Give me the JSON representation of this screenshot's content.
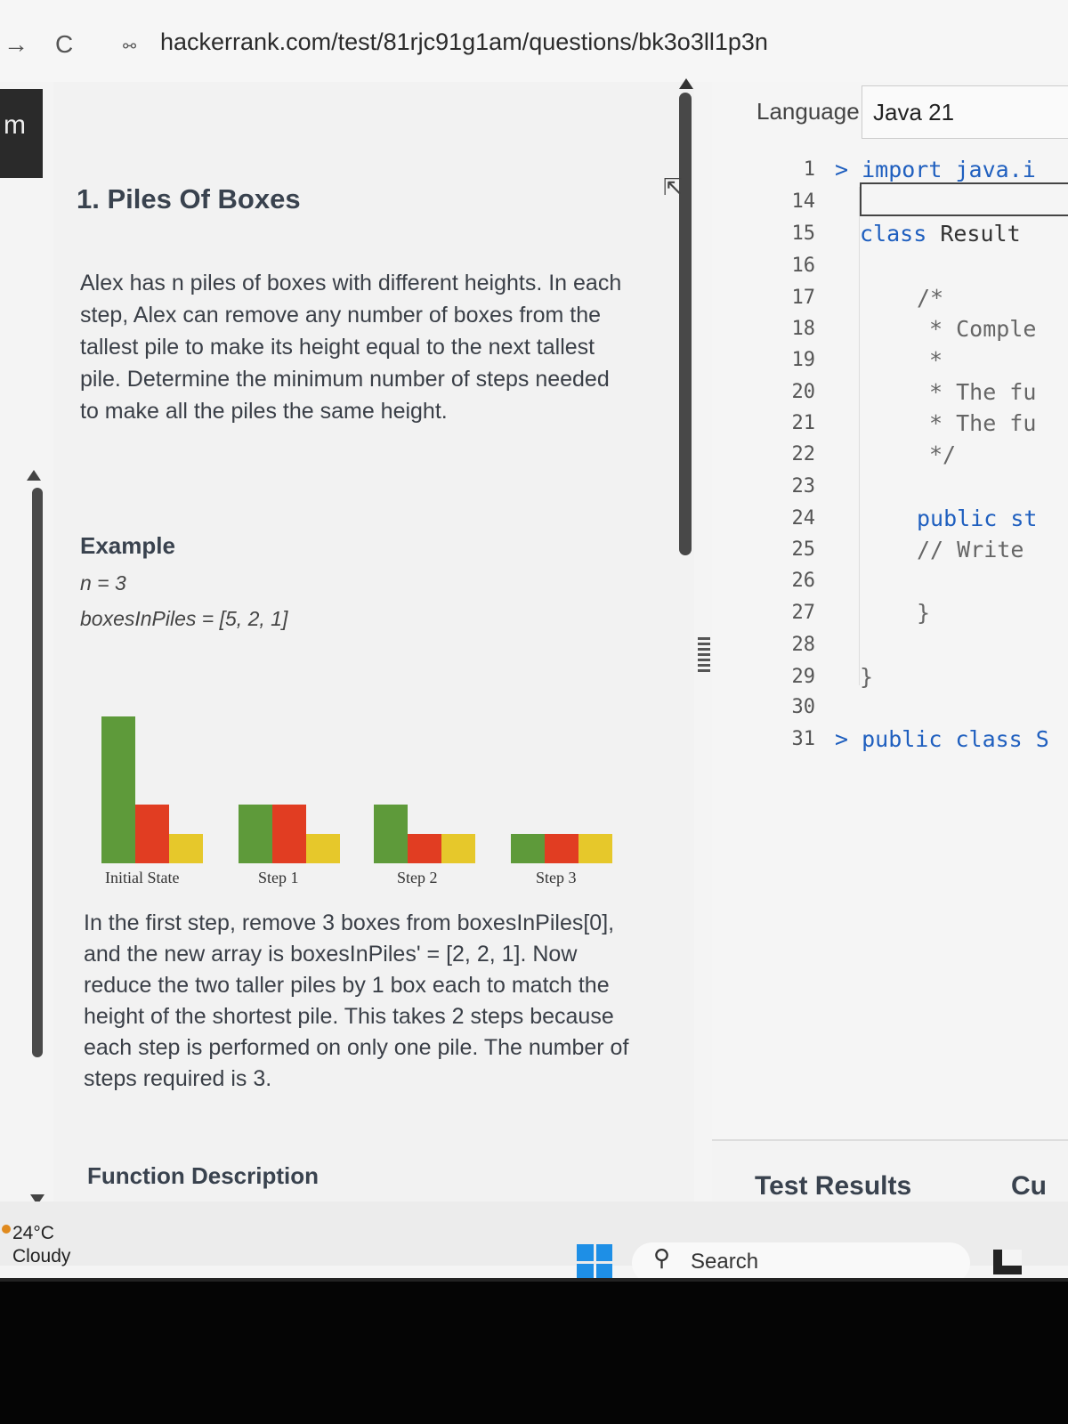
{
  "browser": {
    "back_glyph": "→",
    "reload_glyph": "C",
    "url": "hackerrank.com/test/81rjc91g1am/questions/bk3o3ll1p3n"
  },
  "left_strip": {
    "label": "m"
  },
  "problem": {
    "title": "1. Piles Of Boxes",
    "description": "Alex has n piles of boxes with different heights. In each step, Alex can remove any number of boxes from the tallest pile to make its height equal to the next tallest pile. Determine the minimum number of steps needed to make all the piles the same height.",
    "example_title": "Example",
    "example_n": "n = 3",
    "example_array": "boxesInPiles = [5, 2, 1]",
    "explanation": "In the first step, remove 3 boxes from boxesInPiles[0], and the new array is boxesInPiles' = [2, 2, 1]. Now reduce the two taller piles by 1 box each to match the height of the shortest pile. This takes 2 steps because each step is performed on only one pile. The number of steps required is 3.",
    "function_description_title": "Function Description"
  },
  "chart_data": {
    "type": "bar",
    "categories": [
      "Initial State",
      "Step 1",
      "Step 2",
      "Step 3"
    ],
    "series": [
      {
        "color": "#5e9a3a",
        "values": [
          5,
          2,
          2,
          1
        ]
      },
      {
        "color": "#e13d22",
        "values": [
          2,
          2,
          1,
          1
        ]
      },
      {
        "color": "#e6c82b",
        "values": [
          1,
          1,
          1,
          1
        ]
      }
    ]
  },
  "editor": {
    "language_label": "Language",
    "language_value": "Java 21",
    "lines": [
      {
        "num": "1",
        "text": "> import java.i",
        "kind": "kw"
      },
      {
        "num": "14",
        "text": "",
        "kind": "plain"
      },
      {
        "num": "15",
        "text": "class Result",
        "kind": "class"
      },
      {
        "num": "16",
        "text": "",
        "kind": "plain"
      },
      {
        "num": "17",
        "text": "/*",
        "kind": "cmt"
      },
      {
        "num": "18",
        "text": "* Comple",
        "kind": "cmt"
      },
      {
        "num": "19",
        "text": "*",
        "kind": "cmt"
      },
      {
        "num": "20",
        "text": "* The fu",
        "kind": "cmt"
      },
      {
        "num": "21",
        "text": "* The fu",
        "kind": "cmt"
      },
      {
        "num": "22",
        "text": "*/",
        "kind": "cmt"
      },
      {
        "num": "23",
        "text": "",
        "kind": "plain"
      },
      {
        "num": "24",
        "text": "public st",
        "kind": "kw"
      },
      {
        "num": "25",
        "text": "// Write",
        "kind": "cmt"
      },
      {
        "num": "26",
        "text": "",
        "kind": "plain"
      },
      {
        "num": "27",
        "text": "}",
        "kind": "cmt"
      },
      {
        "num": "28",
        "text": "",
        "kind": "plain"
      },
      {
        "num": "29",
        "text": "}",
        "kind": "cmt"
      },
      {
        "num": "30",
        "text": "",
        "kind": "plain"
      },
      {
        "num": "31",
        "text": "> public class S",
        "kind": "kw"
      }
    ]
  },
  "results": {
    "test_results": "Test Results",
    "custom": "Cu"
  },
  "taskbar": {
    "weather_temp": "24°C",
    "weather_cond": "Cloudy",
    "search_label": "Search"
  }
}
